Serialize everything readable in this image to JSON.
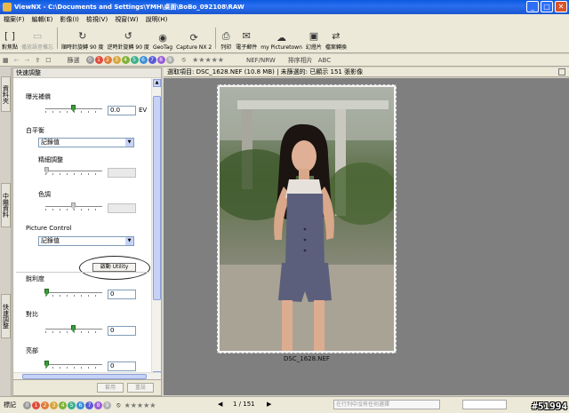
{
  "window": {
    "title": "ViewNX - C:\\Documents and Settings\\YMH\\桌面\\BoBo_092108\\RAW"
  },
  "menu": [
    "檔案(F)",
    "編輯(E)",
    "影像(I)",
    "檢視(V)",
    "視窗(W)",
    "說明(H)"
  ],
  "toolbar": {
    "buttons": [
      {
        "label": "對焦點",
        "icon": "focus-point-icon",
        "enabled": true
      },
      {
        "label": "播放語音備忘",
        "icon": "play-voice-memo-icon",
        "enabled": false
      },
      {
        "label": "順時針旋轉 90 度",
        "icon": "rotate-cw-icon",
        "enabled": true
      },
      {
        "label": "逆時針旋轉 90 度",
        "icon": "rotate-ccw-icon",
        "enabled": true
      },
      {
        "label": "GeoTag",
        "icon": "geotag-icon",
        "enabled": true
      },
      {
        "label": "Capture NX 2",
        "icon": "capture-nx-icon",
        "enabled": true
      },
      {
        "label": "列印",
        "icon": "print-icon",
        "enabled": true
      },
      {
        "label": "電子郵件",
        "icon": "email-icon",
        "enabled": true
      },
      {
        "label": "my Picturetown",
        "icon": "picturetown-icon",
        "enabled": true
      },
      {
        "label": "幻燈片",
        "icon": "slideshow-icon",
        "enabled": true
      },
      {
        "label": "檔案轉換",
        "icon": "file-convert-icon",
        "enabled": true
      }
    ]
  },
  "toolbar2": {
    "filter_label": "篩選",
    "rating_dots": [
      "0",
      "1",
      "2",
      "3",
      "4",
      "5",
      "6",
      "7",
      "8",
      "9"
    ],
    "file_type": "NEF/NRW",
    "sort_label": "排序相片",
    "abc": "ABC"
  },
  "side_tabs": [
    "資料夾",
    "中繼資料",
    "快速調整"
  ],
  "adjust_panel": {
    "title": "快速調整",
    "exposure_label": "曝光補償",
    "exposure_value": "0.0",
    "exposure_unit": "EV",
    "wb_label": "白平衡",
    "wb_value": "記錄值",
    "fine_label": "精細調整",
    "tint_label": "色調",
    "picture_control_label": "Picture Control",
    "picture_control_value": "記錄值",
    "launch_utility": "啟動 Utility",
    "sharpness_label": "銳利度",
    "sharpness_value": "0",
    "contrast_label": "對比",
    "contrast_value": "0",
    "brightness_label": "亮部",
    "brightness_value": "0",
    "apply_label": "套用",
    "reset_label": "重設"
  },
  "viewer": {
    "status_text": "選取項目: DSC_1628.NEF (10.8 MB) | 未篩選的: 已顯示 151 張影像",
    "caption": "DSC_1628.NEF"
  },
  "statusbar": {
    "mark_label": "標記",
    "page": "1 / 151",
    "search_placeholder": "在行列中沒有任何選擇",
    "watermark": "#51994"
  },
  "colors": {
    "titlebar": "#0a5adf",
    "slider_knob": "#3b9b3b",
    "dot_colors": [
      "#999999",
      "#e04a3c",
      "#e07c3c",
      "#d8a53a",
      "#7fb23a",
      "#3bb08a",
      "#3a8fd8",
      "#5a5ad8",
      "#9a5ad8",
      "#b0b0b0"
    ]
  }
}
